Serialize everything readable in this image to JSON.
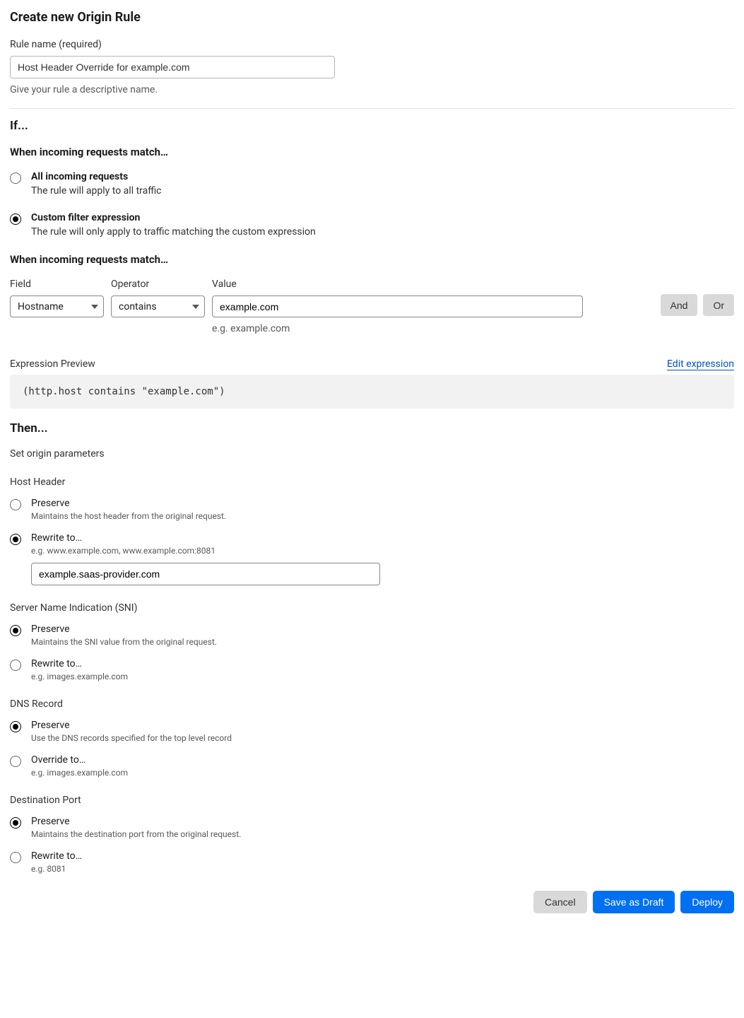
{
  "title": "Create new Origin Rule",
  "rule_name": {
    "label": "Rule name (required)",
    "value": "Host Header Override for example.com",
    "helper": "Give your rule a descriptive name."
  },
  "if_heading": "If...",
  "match_heading": "When incoming requests match…",
  "radios": {
    "all": {
      "title": "All incoming requests",
      "desc": "The rule will apply to all traffic"
    },
    "custom": {
      "title": "Custom filter expression",
      "desc": "The rule will only apply to traffic matching the custom expression"
    }
  },
  "filter_heading": "When incoming requests match…",
  "filter": {
    "field_label": "Field",
    "field_value": "Hostname",
    "operator_label": "Operator",
    "operator_value": "contains",
    "value_label": "Value",
    "value": "example.com",
    "value_helper": "e.g. example.com",
    "and": "And",
    "or": "Or"
  },
  "expression": {
    "label": "Expression Preview",
    "edit": "Edit expression",
    "text": "(http.host contains \"example.com\")"
  },
  "then_heading": "Then...",
  "then_sub": "Set origin parameters",
  "host_header": {
    "label": "Host Header",
    "preserve": {
      "title": "Preserve",
      "desc": "Maintains the host header from the original request."
    },
    "rewrite": {
      "title": "Rewrite to…",
      "desc": "e.g. www.example.com, www.example.com:8081",
      "value": "example.saas-provider.com"
    }
  },
  "sni": {
    "label": "Server Name Indication (SNI)",
    "preserve": {
      "title": "Preserve",
      "desc": "Maintains the SNI value from the original request."
    },
    "rewrite": {
      "title": "Rewrite to…",
      "desc": "e.g. images.example.com"
    }
  },
  "dns": {
    "label": "DNS Record",
    "preserve": {
      "title": "Preserve",
      "desc": "Use the DNS records specified for the top level record"
    },
    "override": {
      "title": "Override to…",
      "desc": "e.g. images.example.com"
    }
  },
  "port": {
    "label": "Destination Port",
    "preserve": {
      "title": "Preserve",
      "desc": "Maintains the destination port from the original request."
    },
    "rewrite": {
      "title": "Rewrite to…",
      "desc": "e.g. 8081"
    }
  },
  "footer": {
    "cancel": "Cancel",
    "draft": "Save as Draft",
    "deploy": "Deploy"
  }
}
